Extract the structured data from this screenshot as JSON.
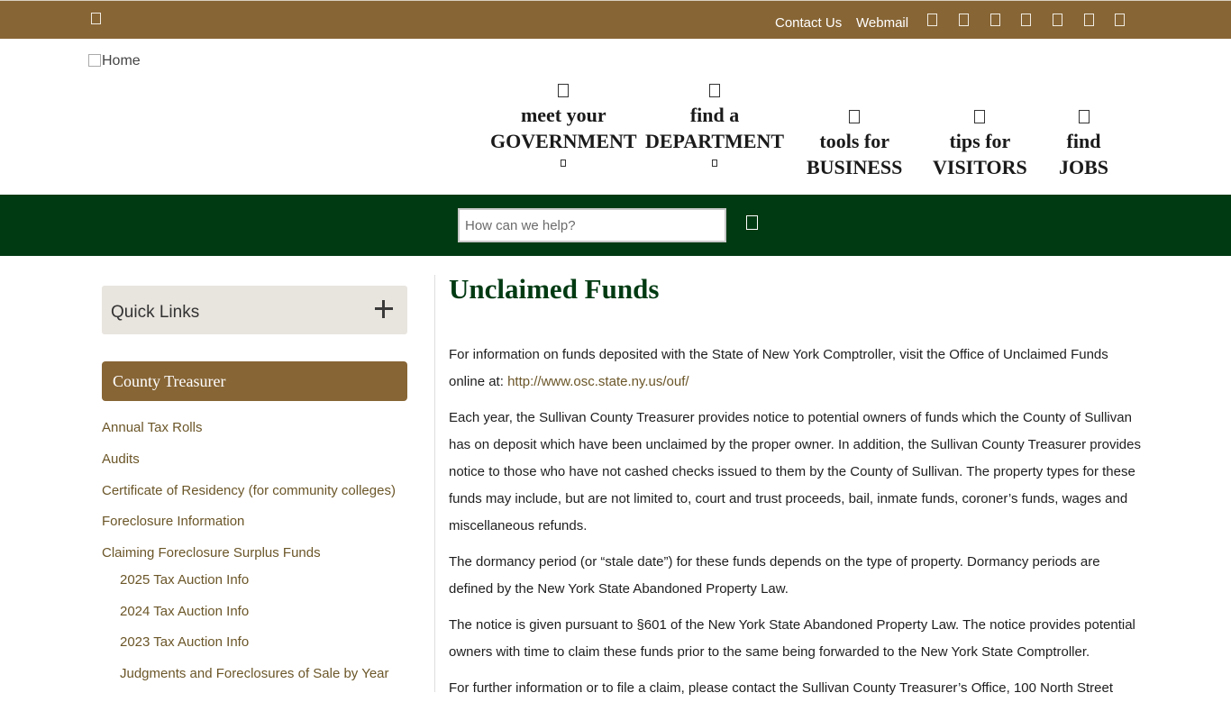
{
  "top_bar": {
    "links": {
      "contact": "Contact Us",
      "webmail": "Webmail"
    },
    "social_icons": [
      "social-icon-1",
      "social-icon-2",
      "social-icon-3",
      "social-icon-4",
      "social-icon-5",
      "social-icon-6",
      "social-icon-7"
    ],
    "background_color": "#876535"
  },
  "header": {
    "logo_alt": "Home",
    "nav": [
      {
        "line1": "meet your",
        "line2": "GOVERNMENT"
      },
      {
        "line1": "find a",
        "line2": "DEPARTMENT"
      },
      {
        "line1": "tools for",
        "line2": "BUSINESS"
      },
      {
        "line1": "tips for",
        "line2": "VISITORS"
      },
      {
        "line1": "find",
        "line2": "JOBS"
      }
    ]
  },
  "search": {
    "placeholder": "How can we help?",
    "bar_color": "#003a12"
  },
  "sidebar": {
    "quick_links": "Quick Links",
    "section_title": "County Treasurer",
    "links": [
      "Annual Tax Rolls",
      "Audits",
      "Certificate of Residency (for community colleges)",
      "Foreclosure Information",
      "Claiming Foreclosure Surplus Funds"
    ],
    "sub_links": [
      "2025 Tax Auction Info",
      "2024 Tax Auction Info",
      "2023 Tax Auction Info",
      "Judgments and Foreclosures of Sale by Year"
    ]
  },
  "main": {
    "title": "Unclaimed Funds",
    "p1_text": "For information on funds deposited with the State of New York Comptroller, visit the Office of Unclaimed Funds online at:",
    "p1_link": "http://www.osc.state.ny.us/ouf/",
    "p2": "Each year, the Sullivan County Treasurer provides notice to potential owners of funds which the County of Sullivan has on deposit which have been unclaimed by the proper owner.  In addition, the Sullivan County Treasurer provides notice to those who have not cashed checks issued to them by the County of Sullivan.  The property types for these funds may include, but are not limited to, court and trust proceeds, bail, inmate funds, coroner’s funds, wages and miscellaneous refunds.",
    "p3": "The dormancy period (or “stale date”) for these funds depends on the type of property.  Dormancy periods are defined by the New York State Abandoned Property Law.",
    "p4": "The notice is given pursuant to §601 of the New York State Abandoned Property Law.  The notice provides potential owners with time to claim these funds prior to the same being forwarded to the New York State Comptroller.",
    "p5": "For further information or to file a claim, please contact the Sullivan County Treasurer’s Office, 100 North Street"
  }
}
